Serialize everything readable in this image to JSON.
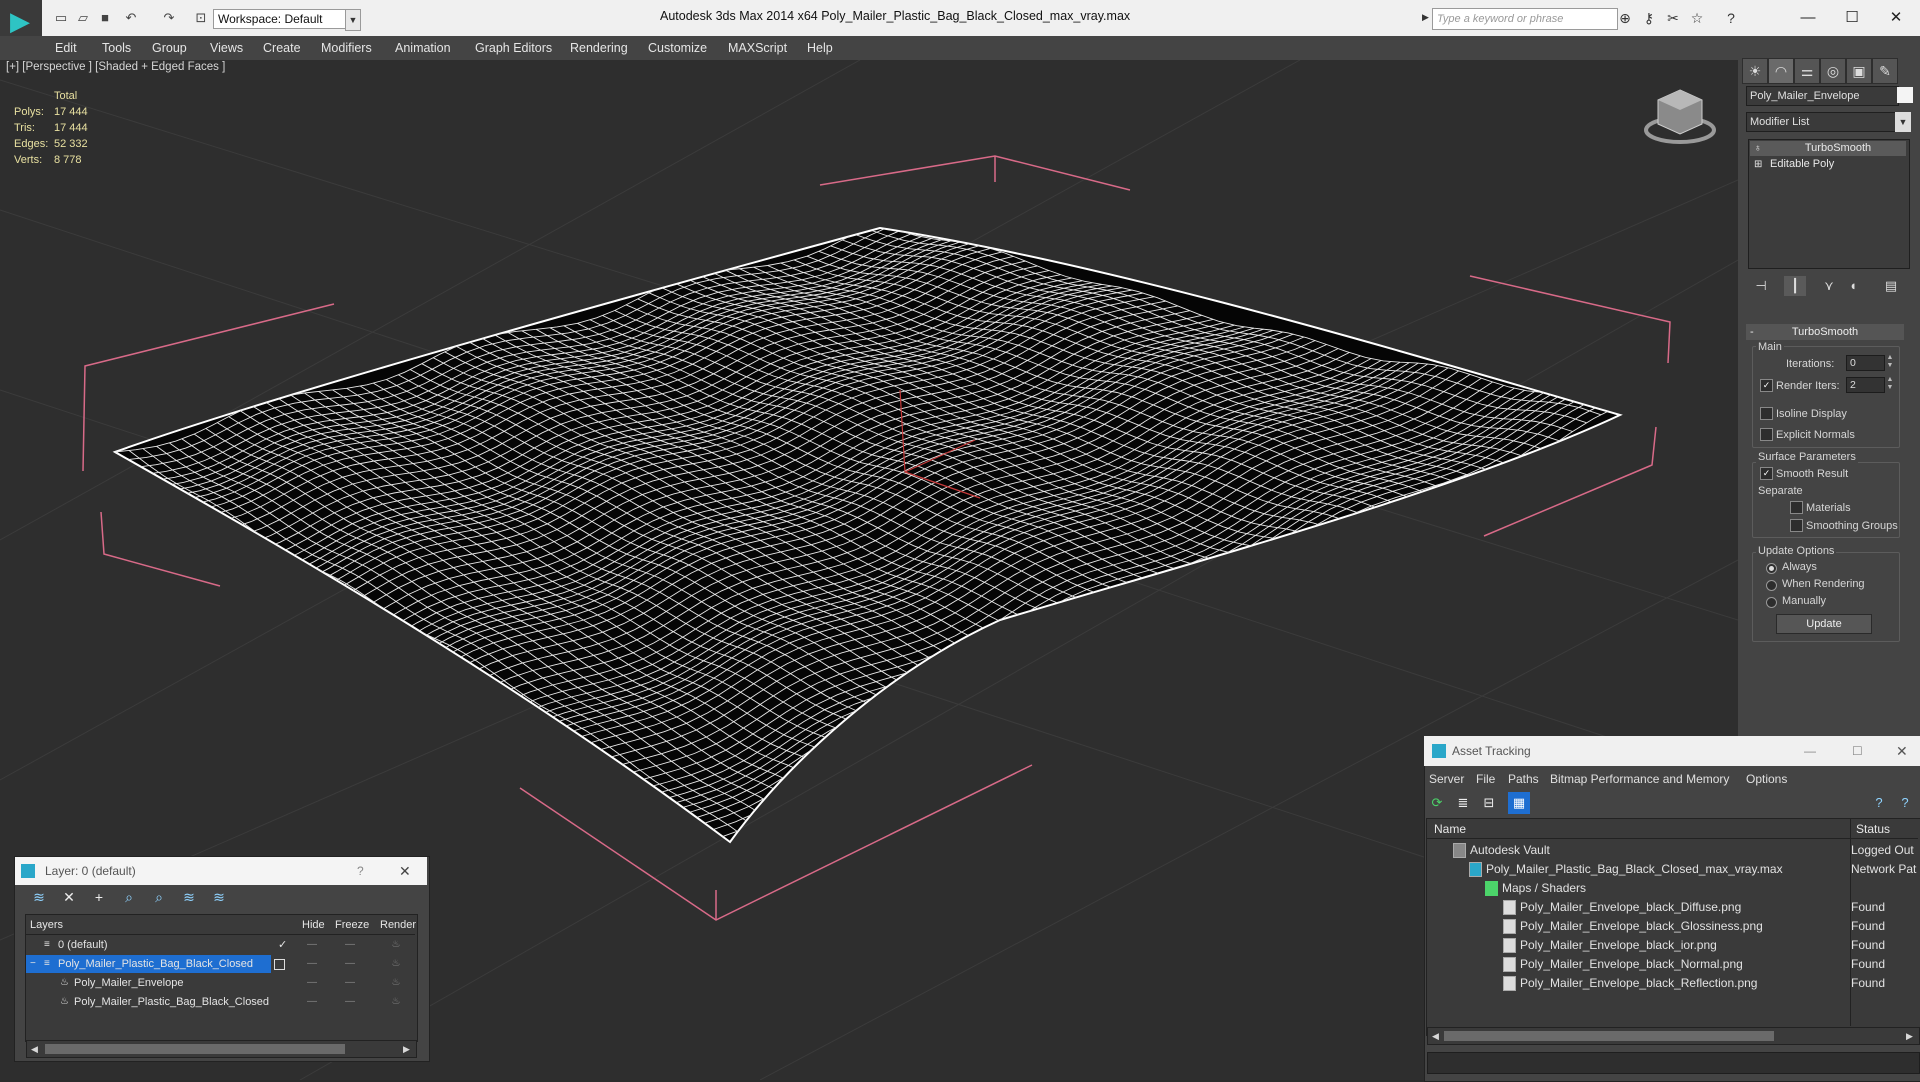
{
  "titlebar": {
    "workspace": "Workspace: Default",
    "app_title": "Autodesk 3ds Max  2014 x64      Poly_Mailer_Plastic_Bag_Black_Closed_max_vray.max",
    "search_placeholder": "Type a keyword or phrase",
    "minimize": "—",
    "maximize": "☐",
    "close": "✕"
  },
  "menubar": [
    "Edit",
    "Tools",
    "Group",
    "Views",
    "Create",
    "Modifiers",
    "Animation",
    "Graph Editors",
    "Rendering",
    "Customize",
    "MAXScript",
    "Help"
  ],
  "viewport": {
    "label": "[+] [Perspective ] [Shaded + Edged Faces ]",
    "stats": {
      "header": "Total",
      "rows": [
        {
          "key": "Polys:",
          "value": "17 444"
        },
        {
          "key": "Tris:",
          "value": "17 444"
        },
        {
          "key": "Edges:",
          "value": "52 332"
        },
        {
          "key": "Verts:",
          "value": "8 778"
        }
      ]
    },
    "colors": {
      "background": "#2e2e2e",
      "grid": "#3a3a3a",
      "wire": "#ffffff",
      "bbox": "#e06a8a"
    }
  },
  "command_panel": {
    "object_name": "Poly_Mailer_Envelope",
    "modifier_list": "Modifier List",
    "stack": [
      "TurboSmooth",
      "Editable Poly"
    ],
    "rollout_title": "TurboSmooth",
    "main_label": "Main",
    "iterations_label": "Iterations:",
    "iterations_value": "0",
    "render_iters_label": "Render Iters:",
    "render_iters_value": "2",
    "render_iters_checked": true,
    "isoline_label": "Isoline Display",
    "explicit_label": "Explicit Normals",
    "surface_label": "Surface Parameters",
    "smooth_label": "Smooth Result",
    "smooth_checked": true,
    "separate_label": "Separate",
    "materials_label": "Materials",
    "smoothing_groups_label": "Smoothing Groups",
    "update_options_label": "Update Options",
    "always_label": "Always",
    "when_rendering_label": "When Rendering",
    "manually_label": "Manually",
    "update_button": "Update"
  },
  "layer_dialog": {
    "title": "Layer: 0 (default)",
    "help": "?",
    "close": "✕",
    "columns": {
      "layers": "Layers",
      "hide": "Hide",
      "freeze": "Freeze",
      "render": "Render"
    },
    "rows": [
      {
        "name": "0 (default)"
      },
      {
        "name": "Poly_Mailer_Plastic_Bag_Black_Closed"
      },
      {
        "name": "Poly_Mailer_Envelope"
      },
      {
        "name": "Poly_Mailer_Plastic_Bag_Black_Closed"
      }
    ]
  },
  "asset_tracking": {
    "title": "Asset Tracking",
    "menu": [
      "Server",
      "File",
      "Paths",
      "Bitmap Performance and Memory",
      "Options"
    ],
    "columns": {
      "name": "Name",
      "status": "Status"
    },
    "rows": [
      {
        "name": "Autodesk Vault",
        "status": "Logged Out"
      },
      {
        "name": "Poly_Mailer_Plastic_Bag_Black_Closed_max_vray.max",
        "status": "Network Pat"
      },
      {
        "name": "Maps / Shaders",
        "status": ""
      },
      {
        "name": "Poly_Mailer_Envelope_black_Diffuse.png",
        "status": "Found"
      },
      {
        "name": "Poly_Mailer_Envelope_black_Glossiness.png",
        "status": "Found"
      },
      {
        "name": "Poly_Mailer_Envelope_black_ior.png",
        "status": "Found"
      },
      {
        "name": "Poly_Mailer_Envelope_black_Normal.png",
        "status": "Found"
      },
      {
        "name": "Poly_Mailer_Envelope_black_Reflection.png",
        "status": "Found"
      }
    ]
  }
}
